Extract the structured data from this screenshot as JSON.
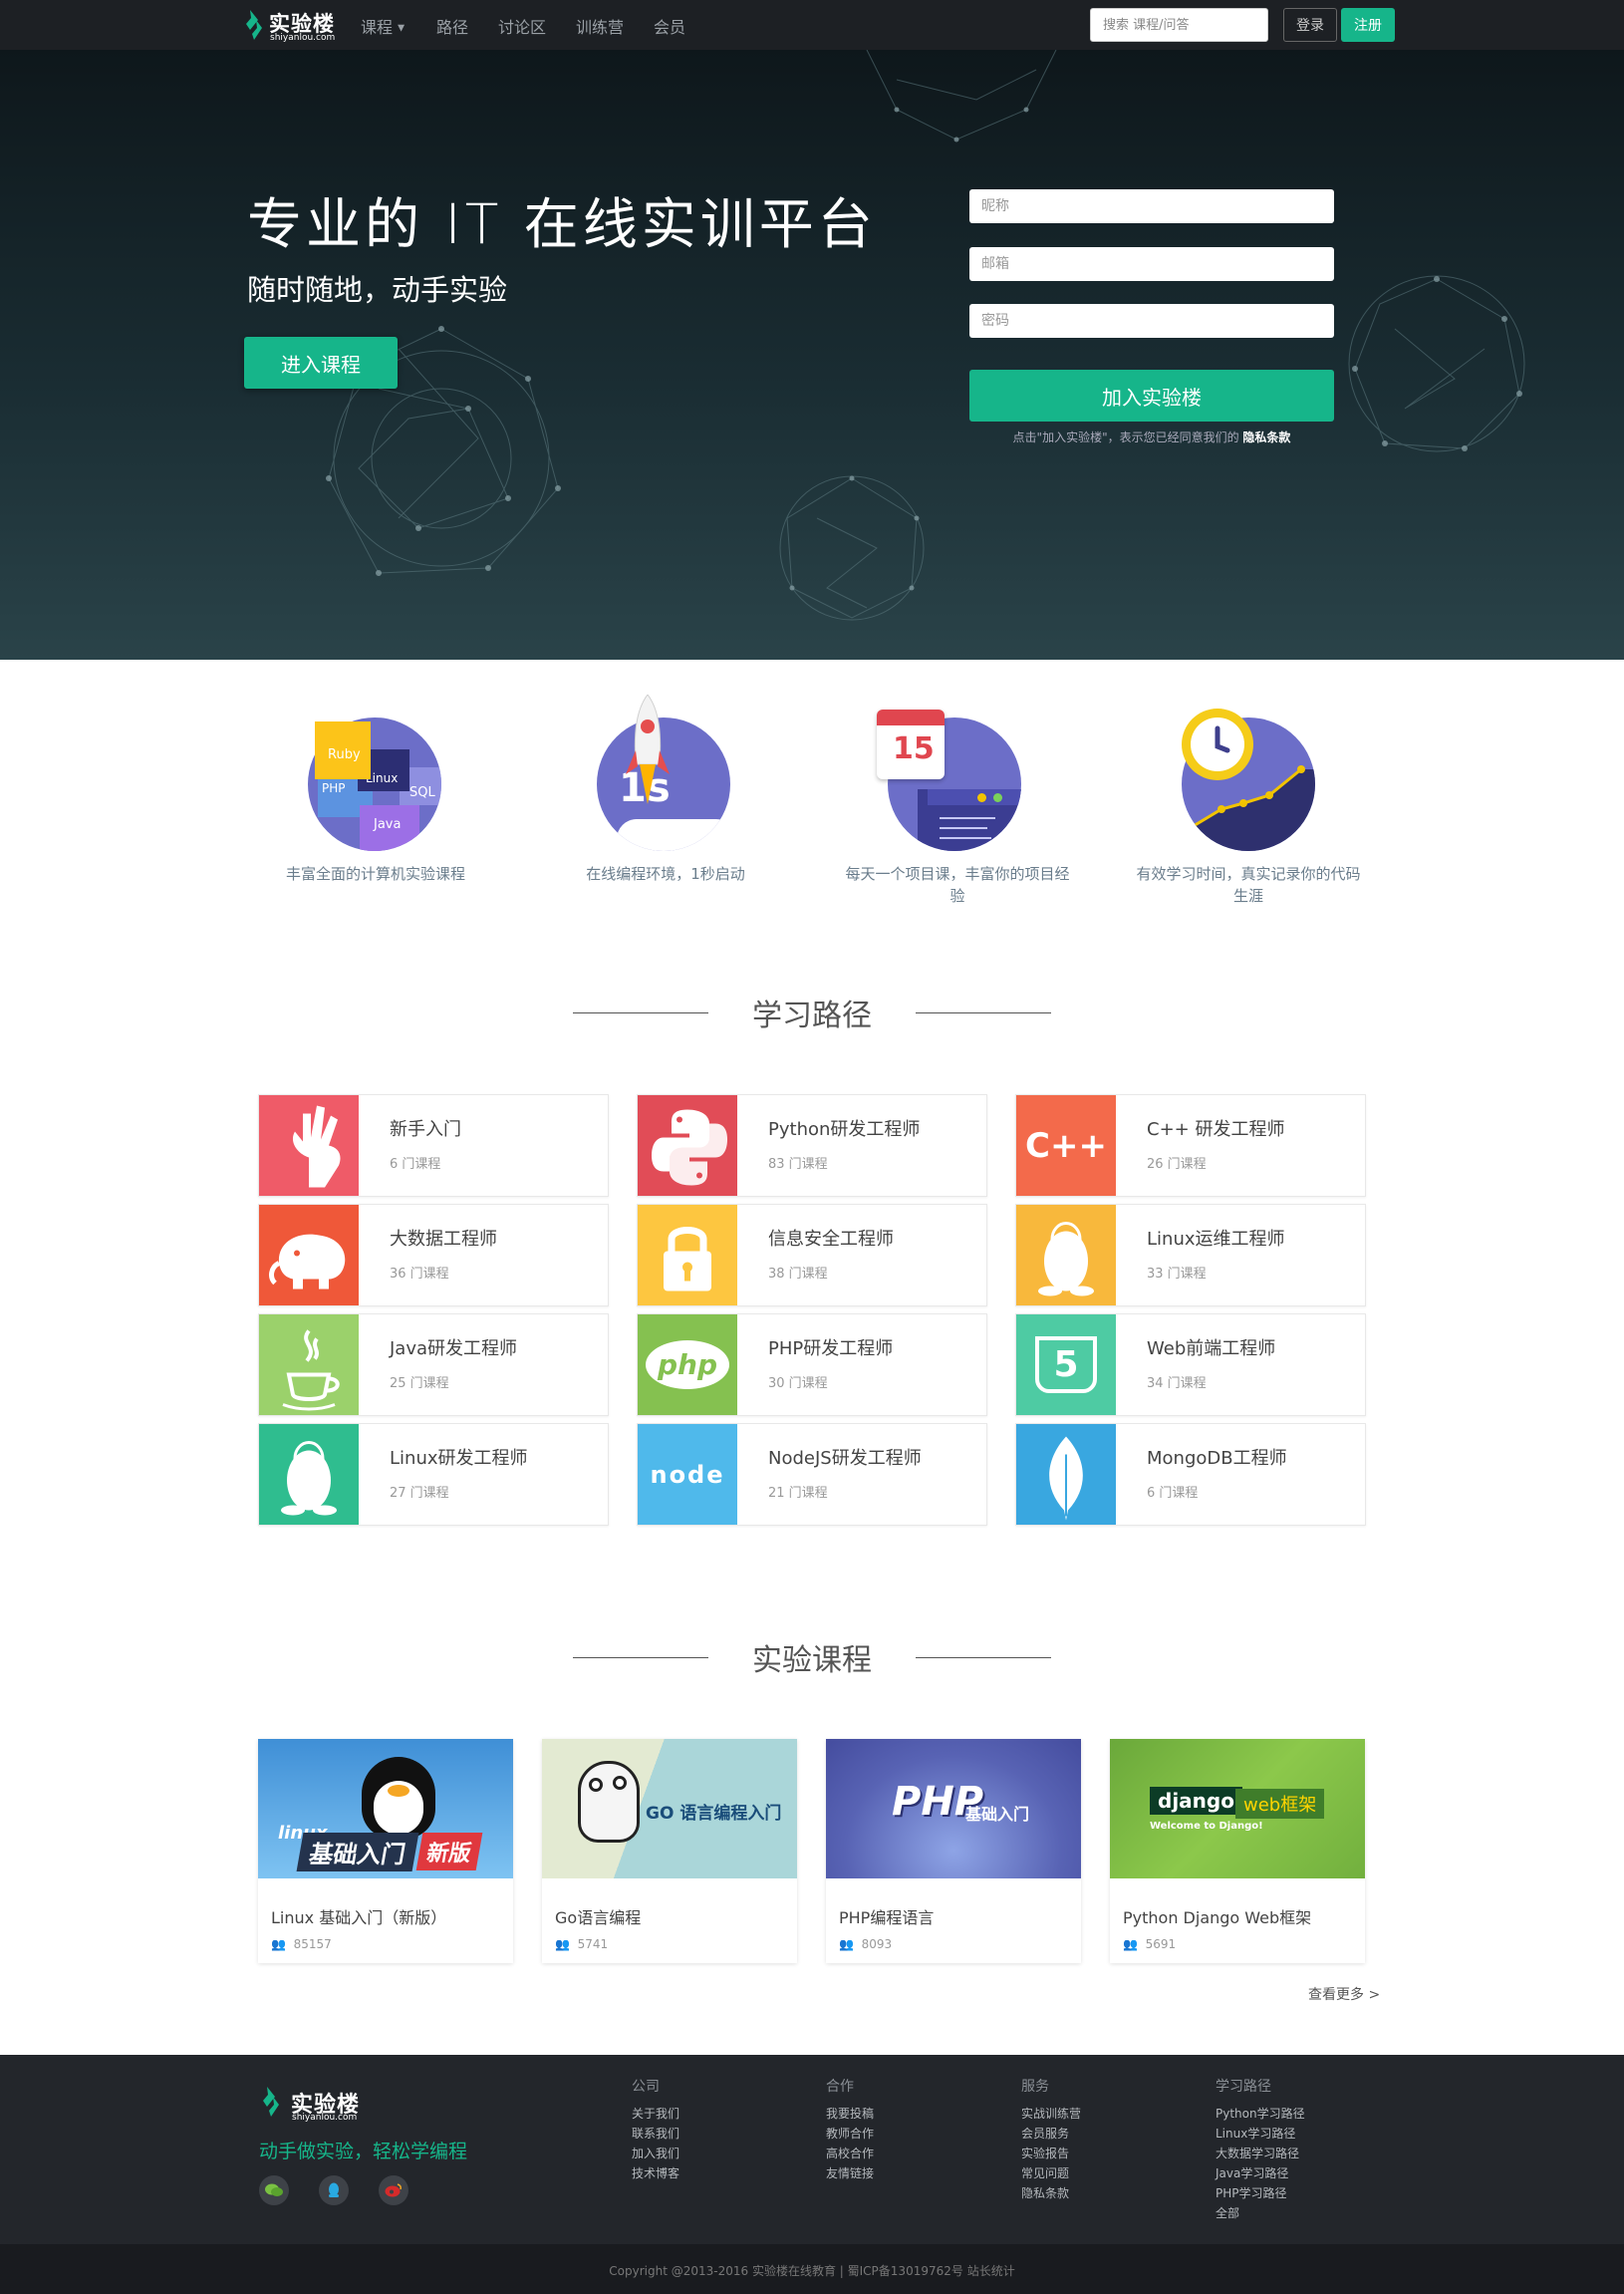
{
  "nav": {
    "logo": {
      "name": "实验楼",
      "sub": "shiyanlou.com"
    },
    "items": [
      "课程",
      "路径",
      "讨论区",
      "训练营",
      "会员"
    ],
    "search_placeholder": "搜索 课程/问答",
    "login": "登录",
    "register": "注册"
  },
  "hero": {
    "title": "专业的 IT 在线实训平台",
    "subtitle": "随时随地，动手实验",
    "enter_button": "进入课程",
    "form": {
      "nickname_placeholder": "昵称",
      "email_placeholder": "邮箱",
      "password_placeholder": "密码",
      "join_button": "加入实验楼",
      "terms_prefix": "点击\"加入实验楼\"，表示您已经同意我们的",
      "terms_link": "隐私条款"
    }
  },
  "features": [
    {
      "text": "丰富全面的计算机实验课程",
      "tags": [
        "Ruby",
        "Linux",
        "SQL",
        "PHP",
        "Java"
      ]
    },
    {
      "text": "在线编程环境，1秒启动",
      "badge": "1s"
    },
    {
      "text": "每天一个项目课，丰富你的项目经验",
      "day": "15"
    },
    {
      "text": "有效学习时间，真实记录你的代码生涯"
    }
  ],
  "paths": {
    "title": "学习路径",
    "items": [
      {
        "name": "新手入门",
        "count": "6 门课程",
        "color": "#ef5b68",
        "icon": "hand-ok-icon"
      },
      {
        "name": "Python研发工程师",
        "count": "83 门课程",
        "color": "#e14c57",
        "icon": "python-icon"
      },
      {
        "name": "C++ 研发工程师",
        "count": "26 门课程",
        "color": "#f36a4b",
        "icon": "cpp-icon",
        "glyph": "C++"
      },
      {
        "name": "大数据工程师",
        "count": "36 门课程",
        "color": "#ef5839",
        "icon": "hadoop-elephant-icon"
      },
      {
        "name": "信息安全工程师",
        "count": "38 门课程",
        "color": "#fdc640",
        "icon": "lock-icon"
      },
      {
        "name": "Linux运维工程师",
        "count": "33 门课程",
        "color": "#f8b83c",
        "icon": "tux-icon"
      },
      {
        "name": "Java研发工程师",
        "count": "25 门课程",
        "color": "#9bd16b",
        "icon": "java-cup-icon"
      },
      {
        "name": "PHP研发工程师",
        "count": "30 门课程",
        "color": "#85c150",
        "icon": "php-icon",
        "glyph": "php"
      },
      {
        "name": "Web前端工程师",
        "count": "34 门课程",
        "color": "#4ecba3",
        "icon": "html5-icon",
        "glyph": "5"
      },
      {
        "name": "Linux研发工程师",
        "count": "27 门课程",
        "color": "#2fbd8f",
        "icon": "tux-icon"
      },
      {
        "name": "NodeJS研发工程师",
        "count": "21 门课程",
        "color": "#4fb9eb",
        "icon": "nodejs-icon",
        "glyph": "node"
      },
      {
        "name": "MongoDB工程师",
        "count": "6 门课程",
        "color": "#39a7e0",
        "icon": "mongodb-leaf-icon"
      }
    ]
  },
  "courses": {
    "title": "实验课程",
    "items": [
      {
        "name": "Linux 基础入门（新版）",
        "stat": "85157",
        "banner": [
          "linux",
          "基础入门",
          "新版"
        ]
      },
      {
        "name": "Go语言编程",
        "stat": "5741",
        "banner": [
          "GO 语言编程入门"
        ]
      },
      {
        "name": "PHP编程语言",
        "stat": "8093",
        "banner": [
          "PHP",
          "基础入门"
        ]
      },
      {
        "name": "Python Django Web框架",
        "stat": "5691",
        "banner": [
          "django",
          "web框架",
          "Welcome to Django!"
        ]
      }
    ],
    "more": "查看更多 >"
  },
  "footer": {
    "logo": {
      "name": "实验楼",
      "sub": "shiyanlou.com"
    },
    "slogan": "动手做实验，轻松学编程",
    "columns": [
      {
        "title": "公司",
        "links": [
          "关于我们",
          "联系我们",
          "加入我们",
          "技术博客"
        ]
      },
      {
        "title": "合作",
        "links": [
          "我要投稿",
          "教师合作",
          "高校合作",
          "友情链接"
        ]
      },
      {
        "title": "服务",
        "links": [
          "实战训练营",
          "会员服务",
          "实验报告",
          "常见问题",
          "隐私条款"
        ]
      },
      {
        "title": "学习路径",
        "links": [
          "Python学习路径",
          "Linux学习路径",
          "大数据学习路径",
          "Java学习路径",
          "PHP学习路径",
          "全部"
        ]
      }
    ],
    "copyright": "Copyright @2013-2016 实验楼在线教育 | 蜀ICP备13019762号 站长统计"
  }
}
